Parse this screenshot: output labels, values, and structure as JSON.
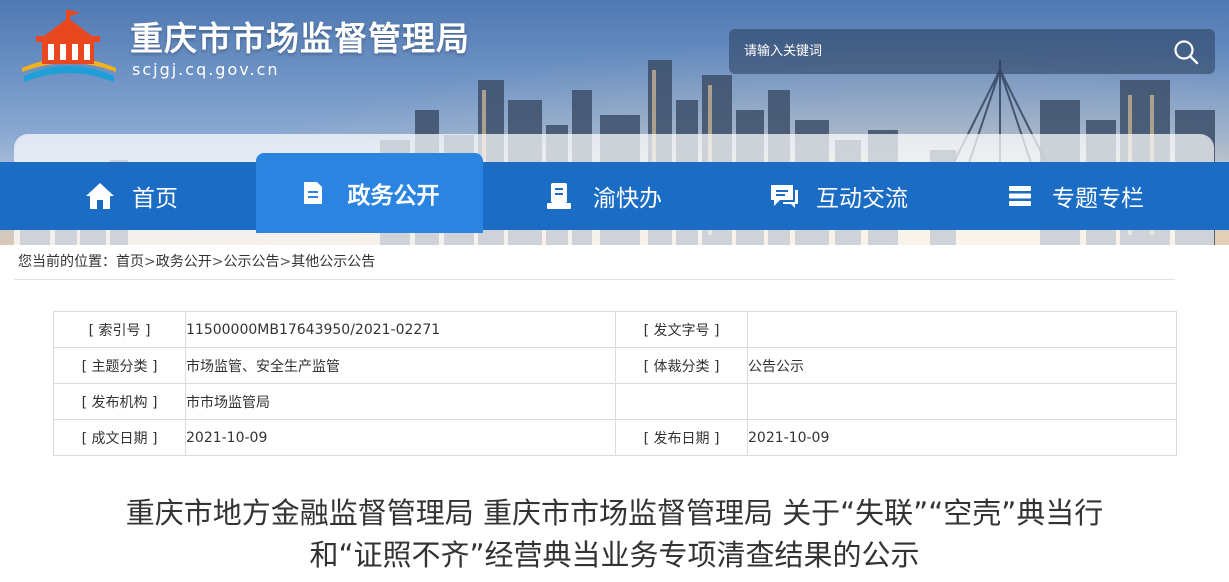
{
  "site": {
    "title": "重庆市市场监督管理局",
    "domain": "scjgj.cq.gov.cn"
  },
  "search": {
    "placeholder": "请输入关键词"
  },
  "nav": {
    "items": [
      {
        "label": "首页",
        "icon": "home-icon"
      },
      {
        "label": "政务公开",
        "icon": "document-icon"
      },
      {
        "label": "渝快办",
        "icon": "service-icon"
      },
      {
        "label": "互动交流",
        "icon": "chat-icon"
      },
      {
        "label": "专题专栏",
        "icon": "topics-icon"
      }
    ],
    "active_index": 1
  },
  "breadcrumb": {
    "prefix": "您当前的位置：",
    "items": [
      "首页",
      "政务公开",
      "公示公告",
      "其他公示公告"
    ],
    "separator": ">"
  },
  "meta": {
    "rows": [
      {
        "label1": "[ 索引号 ]",
        "value1": "11500000MB17643950/2021-02271",
        "label2": "[ 发文字号 ]",
        "value2": ""
      },
      {
        "label1": "[ 主题分类 ]",
        "value1": "市场监管、安全生产监管",
        "label2": "[ 体裁分类 ]",
        "value2": "公告公示"
      },
      {
        "label1": "[ 发布机构 ]",
        "value1": "市市场监管局",
        "label2": "",
        "value2": ""
      },
      {
        "label1": "[ 成文日期 ]",
        "value1": "2021-10-09",
        "label2": "[ 发布日期 ]",
        "value2": "2021-10-09"
      }
    ]
  },
  "article": {
    "title_line1": "重庆市地方金融监督管理局 重庆市市场监督管理局 关于“失联”“空壳”典当行",
    "title_line2": "和“证照不齐”经营典当业务专项清查结果的公示"
  },
  "colors": {
    "nav_bar": "#1a6cc4",
    "nav_active": "#2b84e0"
  }
}
